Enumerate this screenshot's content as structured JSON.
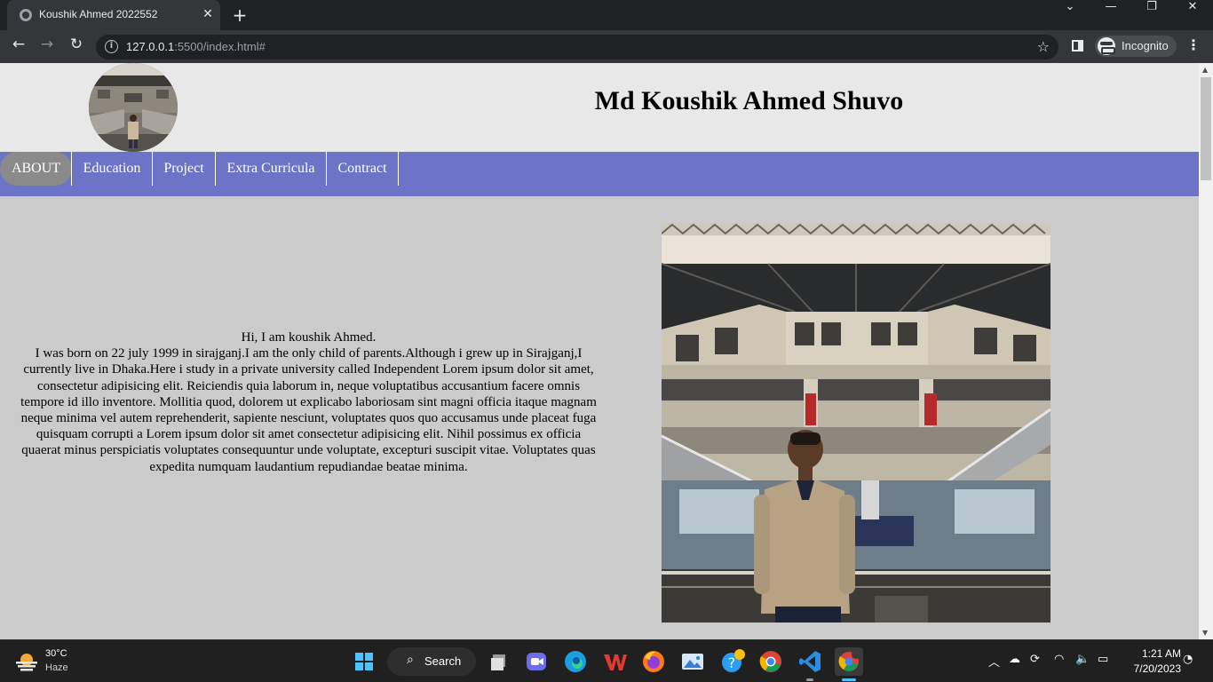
{
  "browser": {
    "tab_title": "Koushik Ahmed 2022552",
    "tab_close": "✕",
    "new_tab": "+",
    "url_host": "127.0.0.1",
    "url_rest": ":5500/index.html#",
    "incognito_label": "Incognito",
    "window_controls": {
      "minimize": "—",
      "restore": "❐",
      "close": "✕",
      "tab_search": "⌄"
    }
  },
  "site": {
    "name": "Md Koushik Ahmed Shuvo",
    "nav": [
      {
        "label": "ABOUT",
        "active": true
      },
      {
        "label": "Education",
        "active": false
      },
      {
        "label": "Project",
        "active": false
      },
      {
        "label": "Extra Curricula",
        "active": false
      },
      {
        "label": "Contract",
        "active": false
      }
    ],
    "about": {
      "greeting": "Hi, I am koushik Ahmed.",
      "body": "I was born on 22 july 1999 in sirajganj.I am the only child of parents.Although i grew up in Sirajganj,I currently live in Dhaka.Here i study in a private university called Independent Lorem ipsum dolor sit amet, consectetur adipisicing elit. Reiciendis quia laborum in, neque voluptatibus accusantium facere omnis tempore id illo inventore. Mollitia quod, dolorem ut explicabo laboriosam sint magni officia itaque magnam neque minima vel autem reprehenderit, sapiente nesciunt, voluptates quos quo accusamus unde placeat fuga quisquam corrupti a Lorem ipsum dolor sit amet consectetur adipisicing elit. Nihil possimus ex officia quaerat minus perspiciatis voluptates consequuntur unde voluptate, excepturi suscipit vitae. Voluptates quas expedita numquam laudantium repudiandae beatae minima."
    },
    "colors": {
      "header_bg": "#e8e8e8",
      "nav_bg": "#6b74c7",
      "body_bg": "#cbcbcb",
      "active_nav_bg": "#8a8a8a"
    }
  },
  "taskbar": {
    "weather_temp": "30°C",
    "weather_condition": "Haze",
    "search_label": "Search",
    "time": "1:21 AM",
    "date": "7/20/2023",
    "apps": [
      "start-icon",
      "search",
      "task-view-icon",
      "meet-icon",
      "edge-icon",
      "wps-icon",
      "firefox-icon",
      "photos-icon",
      "help-icon",
      "chrome-icon",
      "vscode-icon",
      "chrome-incognito-icon"
    ]
  }
}
